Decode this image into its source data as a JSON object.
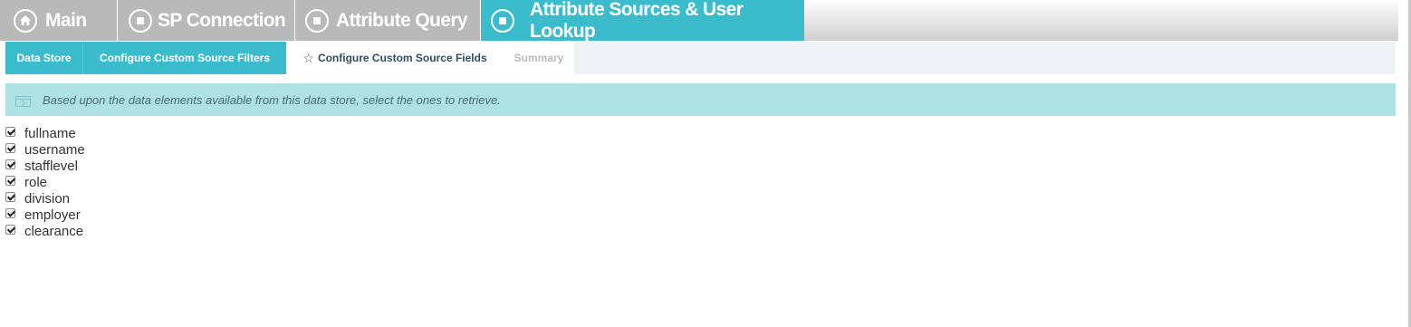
{
  "main_tabs": [
    {
      "label": "Main",
      "icon": "home-icon",
      "active": false
    },
    {
      "label": "SP Connection",
      "icon": "stop-circle-icon",
      "active": false
    },
    {
      "label": "Attribute Query",
      "icon": "stop-circle-icon",
      "active": false
    },
    {
      "label": "Attribute Sources & User Lookup",
      "icon": "stop-circle-icon",
      "active": true
    }
  ],
  "sub_tabs": [
    {
      "label": "Data Store",
      "state": "done"
    },
    {
      "label": "Configure Custom Source Filters",
      "state": "done"
    },
    {
      "label": "Configure Custom Source Fields",
      "state": "current",
      "icon": "star-icon"
    },
    {
      "label": "Summary",
      "state": "pending"
    }
  ],
  "info": {
    "icon": "panel-icon",
    "text": "Based upon the data elements available from this data store, select the ones to retrieve."
  },
  "fields": [
    {
      "label": "fullname",
      "checked": true
    },
    {
      "label": "username",
      "checked": true
    },
    {
      "label": "stafflevel",
      "checked": true
    },
    {
      "label": "role",
      "checked": true
    },
    {
      "label": "division",
      "checked": true
    },
    {
      "label": "employer",
      "checked": true
    },
    {
      "label": "clearance",
      "checked": true
    }
  ],
  "colors": {
    "accent": "#3bbccd",
    "inactive_tab": "#b9b9b9",
    "info_background": "#aee1e3",
    "sub_bar_background": "#eff3f7"
  }
}
